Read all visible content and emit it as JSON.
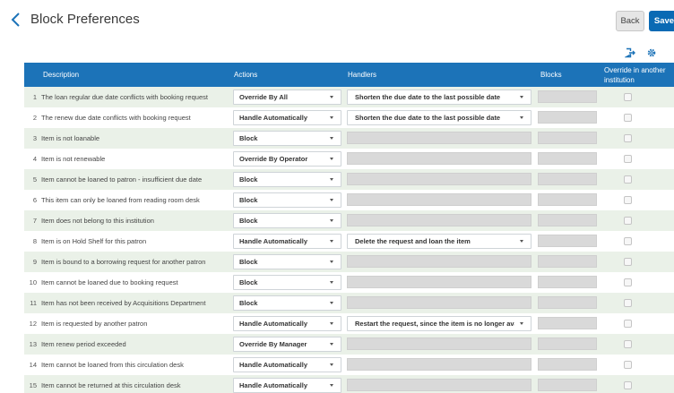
{
  "header": {
    "title": "Block Preferences",
    "back_label": "Back",
    "save_label": "Save"
  },
  "toolbar": {
    "icons": [
      "export-icon",
      "gear-icon"
    ]
  },
  "columns": {
    "description": "Description",
    "actions": "Actions",
    "handlers": "Handlers",
    "blocks": "Blocks",
    "override_line1": "Override in another",
    "override_line2": "institution"
  },
  "rows": [
    {
      "num": "1",
      "desc": "The loan regular due date conflicts with booking request",
      "action": "Override By All",
      "handler": "Shorten the due date to the last possible date"
    },
    {
      "num": "2",
      "desc": "The renew due date conflicts with booking request",
      "action": "Handle Automatically",
      "handler": "Shorten the due date to the last possible date"
    },
    {
      "num": "3",
      "desc": "Item is not loanable",
      "action": "Block",
      "handler": ""
    },
    {
      "num": "4",
      "desc": "Item is not renewable",
      "action": "Override By Operator",
      "handler": ""
    },
    {
      "num": "5",
      "desc": "Item cannot be loaned to patron - insufficient due date",
      "action": "Block",
      "handler": ""
    },
    {
      "num": "6",
      "desc": "This item can only be loaned from reading room desk",
      "action": "Block",
      "handler": ""
    },
    {
      "num": "7",
      "desc": "Item does not belong to this institution",
      "action": "Block",
      "handler": ""
    },
    {
      "num": "8",
      "desc": "Item is on Hold Shelf for this patron",
      "action": "Handle Automatically",
      "handler": "Delete the request and loan the item"
    },
    {
      "num": "9",
      "desc": "Item is bound to a borrowing request for another patron",
      "action": "Block",
      "handler": ""
    },
    {
      "num": "10",
      "desc": "Item cannot be loaned due to booking request",
      "action": "Block",
      "handler": ""
    },
    {
      "num": "11",
      "desc": "Item has not been received by Acquisitions Department",
      "action": "Block",
      "handler": ""
    },
    {
      "num": "12",
      "desc": "Item is requested by another patron",
      "action": "Handle Automatically",
      "handler": "Restart the request, since the item is no longer ava"
    },
    {
      "num": "13",
      "desc": "Item renew period exceeded",
      "action": "Override By Manager",
      "handler": ""
    },
    {
      "num": "14",
      "desc": "Item cannot be loaned from this circulation desk",
      "action": "Handle Automatically",
      "handler": ""
    },
    {
      "num": "15",
      "desc": "Item cannot be returned at this circulation desk",
      "action": "Handle Automatically",
      "handler": ""
    }
  ],
  "colors": {
    "accent": "#1c73b8",
    "save": "#0a6ab4",
    "row_alt": "#eaf1e8"
  }
}
